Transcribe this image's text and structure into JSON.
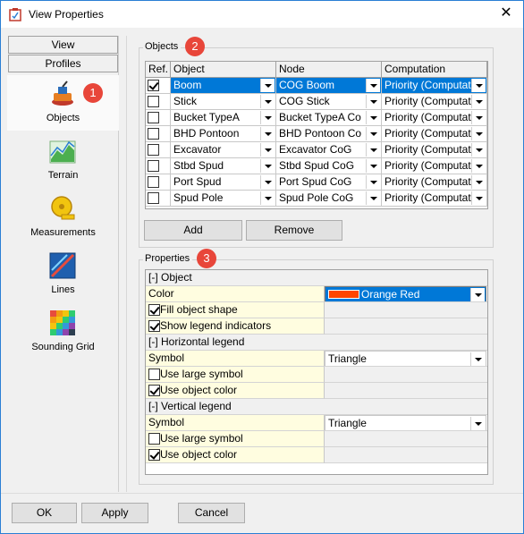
{
  "window": {
    "title": "View Properties",
    "close_glyph": "✕"
  },
  "nav": {
    "tabs": {
      "view": "View",
      "profiles": "Profiles"
    },
    "items": [
      {
        "label": "Objects",
        "icon": "objects-icon"
      },
      {
        "label": "Terrain",
        "icon": "terrain-icon"
      },
      {
        "label": "Measurements",
        "icon": "measurements-icon"
      },
      {
        "label": "Lines",
        "icon": "lines-icon"
      },
      {
        "label": "Sounding Grid",
        "icon": "sounding-grid-icon"
      }
    ]
  },
  "badges": {
    "one": "1",
    "two": "2",
    "three": "3"
  },
  "objects_group": {
    "title": "Objects",
    "columns": {
      "ref": "Ref.",
      "object": "Object",
      "node": "Node",
      "computation": "Computation"
    },
    "rows": [
      {
        "ref": true,
        "object": "Boom",
        "node": "COG Boom",
        "computation": "Priority (Computati",
        "selected": true
      },
      {
        "ref": false,
        "object": "Stick",
        "node": "COG Stick",
        "computation": "Priority (Computati"
      },
      {
        "ref": false,
        "object": "Bucket TypeA",
        "node": "Bucket TypeA Co",
        "computation": "Priority (Computati"
      },
      {
        "ref": false,
        "object": "BHD Pontoon",
        "node": "BHD Pontoon Co",
        "computation": "Priority (Computati"
      },
      {
        "ref": false,
        "object": "Excavator",
        "node": "Excavator CoG",
        "computation": "Priority (Computati"
      },
      {
        "ref": false,
        "object": "Stbd Spud",
        "node": "Stbd Spud CoG",
        "computation": "Priority (Computati"
      },
      {
        "ref": false,
        "object": "Port Spud",
        "node": "Port Spud CoG",
        "computation": "Priority (Computati"
      },
      {
        "ref": false,
        "object": "Spud Pole",
        "node": "Spud Pole CoG",
        "computation": "Priority (Computati"
      }
    ],
    "add_label": "Add",
    "remove_label": "Remove"
  },
  "properties_group": {
    "title": "Properties",
    "object_section": "[-] Object",
    "color_label": "Color",
    "color_value": "Orange Red",
    "color_swatch": "#ff4500",
    "fill_shape": "Fill object shape",
    "show_legend": "Show legend indicators",
    "horiz_section": "[-] Horizontal legend",
    "h_symbol_label": "Symbol",
    "h_symbol_value": "Triangle",
    "h_large_symbol": "Use large symbol",
    "h_object_color": "Use object color",
    "vert_section": "[-] Vertical legend",
    "v_symbol_label": "Symbol",
    "v_symbol_value": "Triangle",
    "v_large_symbol": "Use large symbol",
    "v_object_color": "Use object color"
  },
  "footer": {
    "ok": "OK",
    "apply": "Apply",
    "cancel": "Cancel"
  },
  "colors": {
    "selection": "#0078d7",
    "badge": "#e8463a",
    "window_border": "#2a7fd4"
  }
}
